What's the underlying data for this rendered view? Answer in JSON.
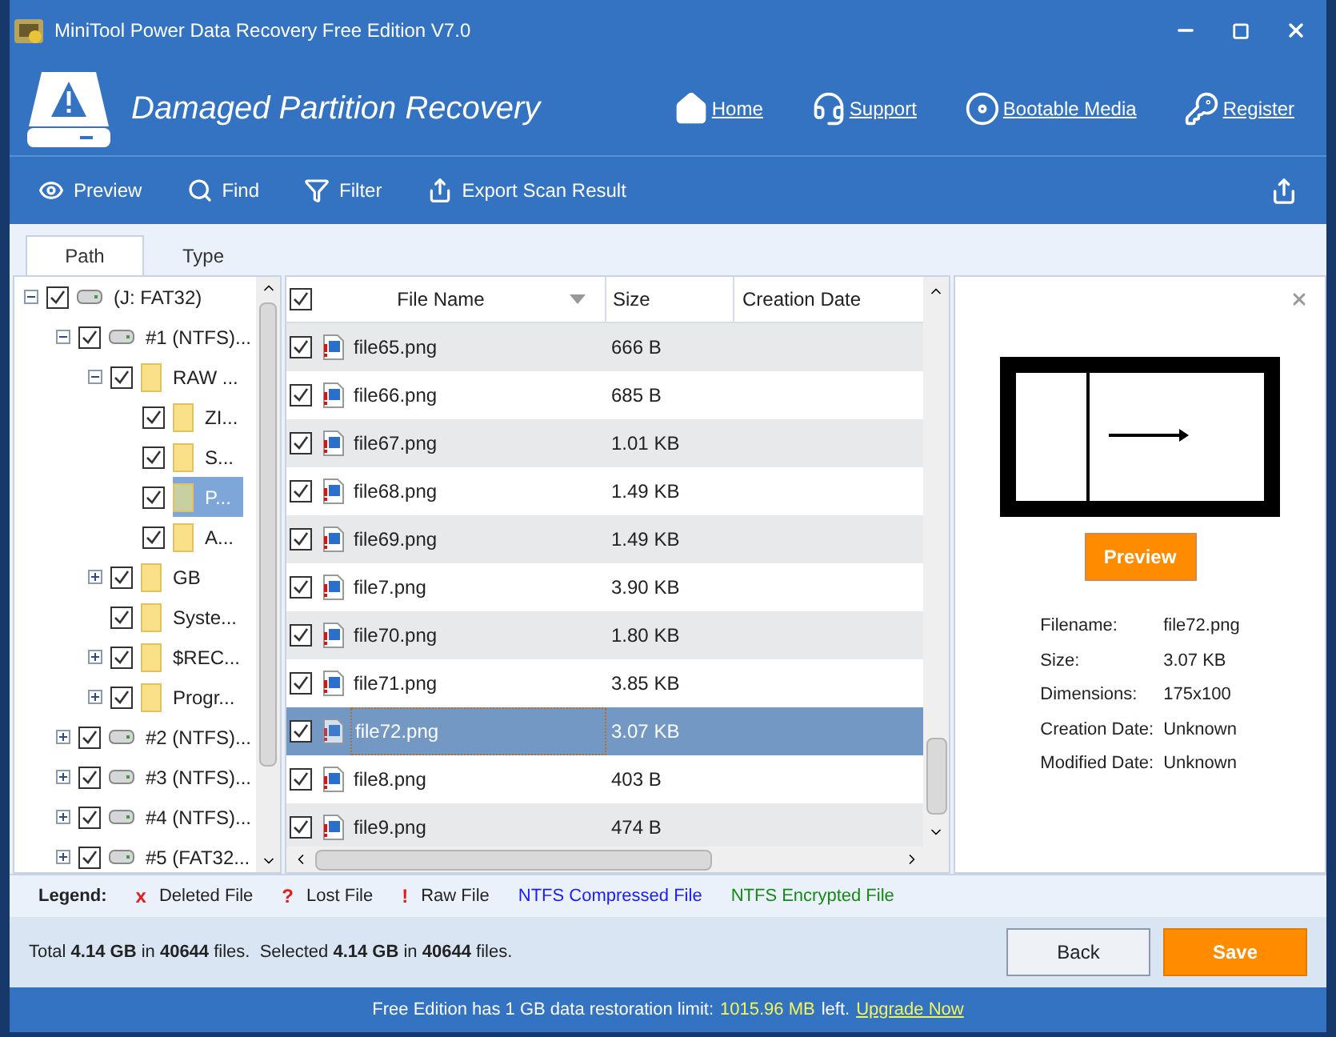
{
  "window": {
    "title": "MiniTool Power Data Recovery Free Edition V7.0"
  },
  "header": {
    "title": "Damaged Partition Recovery",
    "links": [
      {
        "kind": "home",
        "label": "Home"
      },
      {
        "kind": "support",
        "label": "Support"
      },
      {
        "kind": "media",
        "label": "Bootable Media"
      },
      {
        "kind": "register",
        "label": "Register"
      }
    ]
  },
  "toolbar": [
    {
      "kind": "preview",
      "label": "Preview"
    },
    {
      "kind": "find",
      "label": "Find"
    },
    {
      "kind": "filter",
      "label": "Filter"
    },
    {
      "kind": "export",
      "label": "Export Scan Result"
    }
  ],
  "tabs": [
    {
      "label": "Path",
      "selected": true
    },
    {
      "label": "Type",
      "selected": false
    }
  ],
  "tree": [
    {
      "label": "(J: FAT32)",
      "kind": "drive",
      "checked": true,
      "selected": false,
      "expanded": true,
      "children": [
        {
          "label": "#1 (NTFS)...",
          "kind": "drive",
          "checked": true,
          "selected": false,
          "expanded": true,
          "children": [
            {
              "label": "RAW ...",
              "kind": "folder",
              "checked": true,
              "selected": false,
              "expanded": true,
              "children": [
                {
                  "label": "ZI...",
                  "kind": "folder",
                  "checked": true,
                  "selected": false
                },
                {
                  "label": "S...",
                  "kind": "folder",
                  "checked": true,
                  "selected": false
                },
                {
                  "label": "P...",
                  "kind": "folder",
                  "checked": true,
                  "selected": true
                },
                {
                  "label": "A...",
                  "kind": "folder",
                  "checked": true,
                  "selected": false
                }
              ]
            },
            {
              "label": "GB",
              "kind": "folder",
              "checked": true,
              "selected": false,
              "expanded": false
            },
            {
              "label": "Syste...",
              "kind": "folder",
              "checked": true,
              "selected": false
            },
            {
              "label": "$REC...",
              "kind": "folder",
              "checked": true,
              "selected": false,
              "expanded": false
            },
            {
              "label": "Progr...",
              "kind": "folder",
              "checked": true,
              "selected": false,
              "expanded": false
            }
          ]
        },
        {
          "label": "#2 (NTFS)...",
          "kind": "drive",
          "checked": true,
          "selected": false,
          "expanded": false
        },
        {
          "label": "#3 (NTFS)...",
          "kind": "drive",
          "checked": true,
          "selected": false,
          "expanded": false
        },
        {
          "label": "#4 (NTFS)...",
          "kind": "drive",
          "checked": true,
          "selected": false,
          "expanded": false
        },
        {
          "label": "#5 (FAT32...",
          "kind": "drive",
          "checked": true,
          "selected": false,
          "expanded": false
        }
      ]
    }
  ],
  "table": {
    "all_checked": true,
    "columns": [
      "File Name",
      "Size",
      "Creation Date"
    ],
    "rows": [
      {
        "name": "file65.png",
        "size": "666 B",
        "checked": true,
        "selected": false
      },
      {
        "name": "file66.png",
        "size": "685 B",
        "checked": true,
        "selected": false
      },
      {
        "name": "file67.png",
        "size": "1.01 KB",
        "checked": true,
        "selected": false
      },
      {
        "name": "file68.png",
        "size": "1.49 KB",
        "checked": true,
        "selected": false
      },
      {
        "name": "file69.png",
        "size": "1.49 KB",
        "checked": true,
        "selected": false
      },
      {
        "name": "file7.png",
        "size": "3.90 KB",
        "checked": true,
        "selected": false
      },
      {
        "name": "file70.png",
        "size": "1.80 KB",
        "checked": true,
        "selected": false
      },
      {
        "name": "file71.png",
        "size": "3.85 KB",
        "checked": true,
        "selected": false
      },
      {
        "name": "file72.png",
        "size": "3.07 KB",
        "checked": true,
        "selected": true
      },
      {
        "name": "file8.png",
        "size": "403 B",
        "checked": true,
        "selected": false
      },
      {
        "name": "file9.png",
        "size": "474 B",
        "checked": true,
        "selected": false
      }
    ]
  },
  "preview": {
    "button": "Preview",
    "details": [
      {
        "label": "Filename:",
        "value": "file72.png"
      },
      {
        "label": "Size:",
        "value": "3.07 KB"
      },
      {
        "label": "Dimensions:",
        "value": "175x100"
      },
      {
        "label": "Creation Date:",
        "value": "Unknown"
      },
      {
        "label": "Modified Date:",
        "value": "Unknown"
      }
    ]
  },
  "legend": {
    "title": "Legend:",
    "items": [
      {
        "kind": "marked",
        "mark": "x",
        "label": "Deleted File",
        "color": "#e31b1b"
      },
      {
        "kind": "marked",
        "mark": "?",
        "label": "Lost File",
        "color": "#e31b1b"
      },
      {
        "kind": "marked",
        "mark": "!",
        "label": "Raw File",
        "color": "#e31b1b"
      },
      {
        "kind": "colored",
        "label": "NTFS Compressed File",
        "color": "#1a1aff"
      },
      {
        "kind": "colored",
        "label": "NTFS Encrypted File",
        "color": "#148a14"
      }
    ]
  },
  "status": {
    "summary": "Total **4.14 GB** in **40644** files.  Selected **4.14 GB** in **40644** files.",
    "buttons": [
      {
        "kind": "secondary",
        "label": "Back"
      },
      {
        "kind": "primary",
        "label": "Save"
      }
    ]
  },
  "footer": {
    "text": "Free Edition has 1 GB data restoration limit:",
    "remaining": "1015.96 MB",
    "after": "left.",
    "link": "Upgrade Now"
  }
}
